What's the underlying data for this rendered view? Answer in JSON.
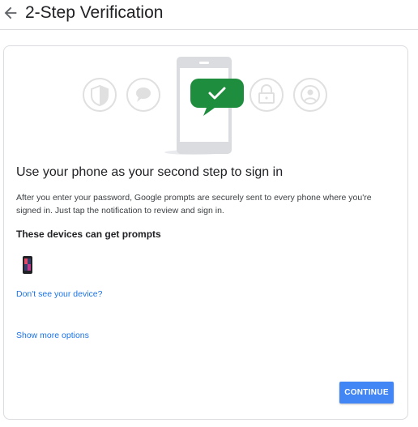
{
  "header": {
    "title": "2-Step Verification"
  },
  "main": {
    "headline": "Use your phone as your second step to sign in",
    "description": "After you enter your password, Google prompts are securely sent to every phone where you're signed in. Just tap the notification to review and sign in.",
    "devices_heading": "These devices can get prompts",
    "dont_see_device_link": "Don't see your device?",
    "show_more_link": "Show more options",
    "continue_label": "CONTINUE"
  },
  "colors": {
    "accent": "#4285f4",
    "link": "#1a73e8",
    "bubble_green": "#1e8e3e",
    "icon_gray": "#e0e0e0"
  },
  "icons": [
    "back-arrow-icon",
    "shield-icon",
    "chat-bubble-icon",
    "check-bubble-icon",
    "lock-icon",
    "account-icon",
    "phone-device-icon"
  ]
}
